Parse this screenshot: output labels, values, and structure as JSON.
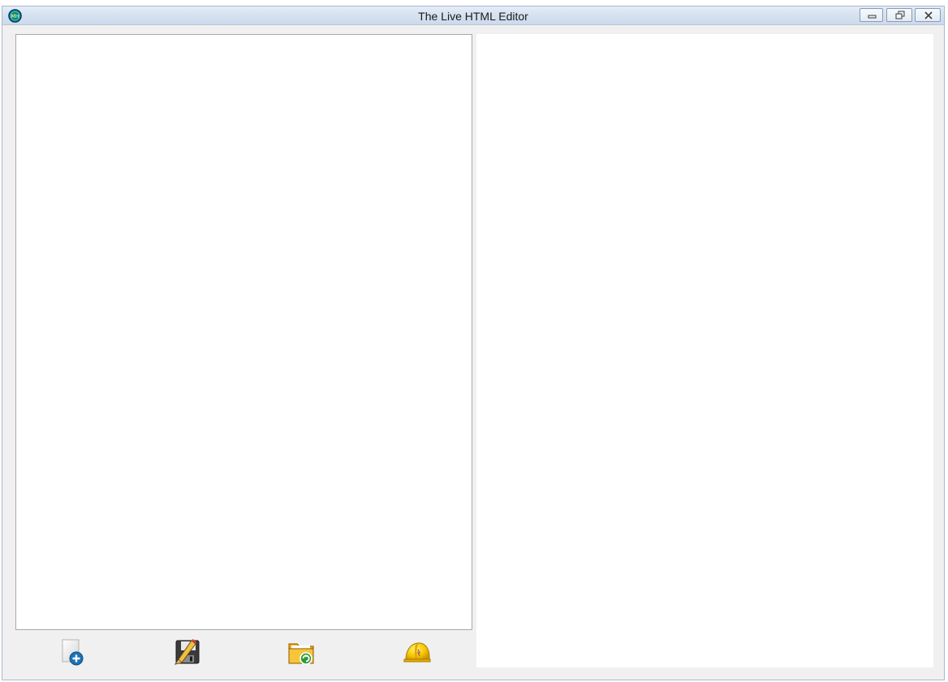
{
  "window": {
    "title": "The Live HTML Editor",
    "app_icon_text": "MH"
  },
  "caption_buttons": [
    {
      "name": "minimize",
      "icon": "minimize-icon"
    },
    {
      "name": "restore",
      "icon": "restore-icon"
    },
    {
      "name": "close",
      "icon": "close-icon"
    }
  ],
  "toolbar": {
    "buttons": [
      {
        "name": "new",
        "icon": "new-document-icon"
      },
      {
        "name": "save",
        "icon": "save-floppy-icon"
      },
      {
        "name": "open",
        "icon": "open-folder-icon"
      },
      {
        "name": "help",
        "icon": "hard-hat-icon"
      }
    ]
  },
  "colors": {
    "titlebar": "#d6e2f0",
    "window_bg": "#f0f0f0",
    "pane_bg": "#ffffff",
    "accent_blue": "#1e6fb0",
    "folder_yellow": "#f5b81b",
    "helmet_yellow": "#f7c600"
  }
}
